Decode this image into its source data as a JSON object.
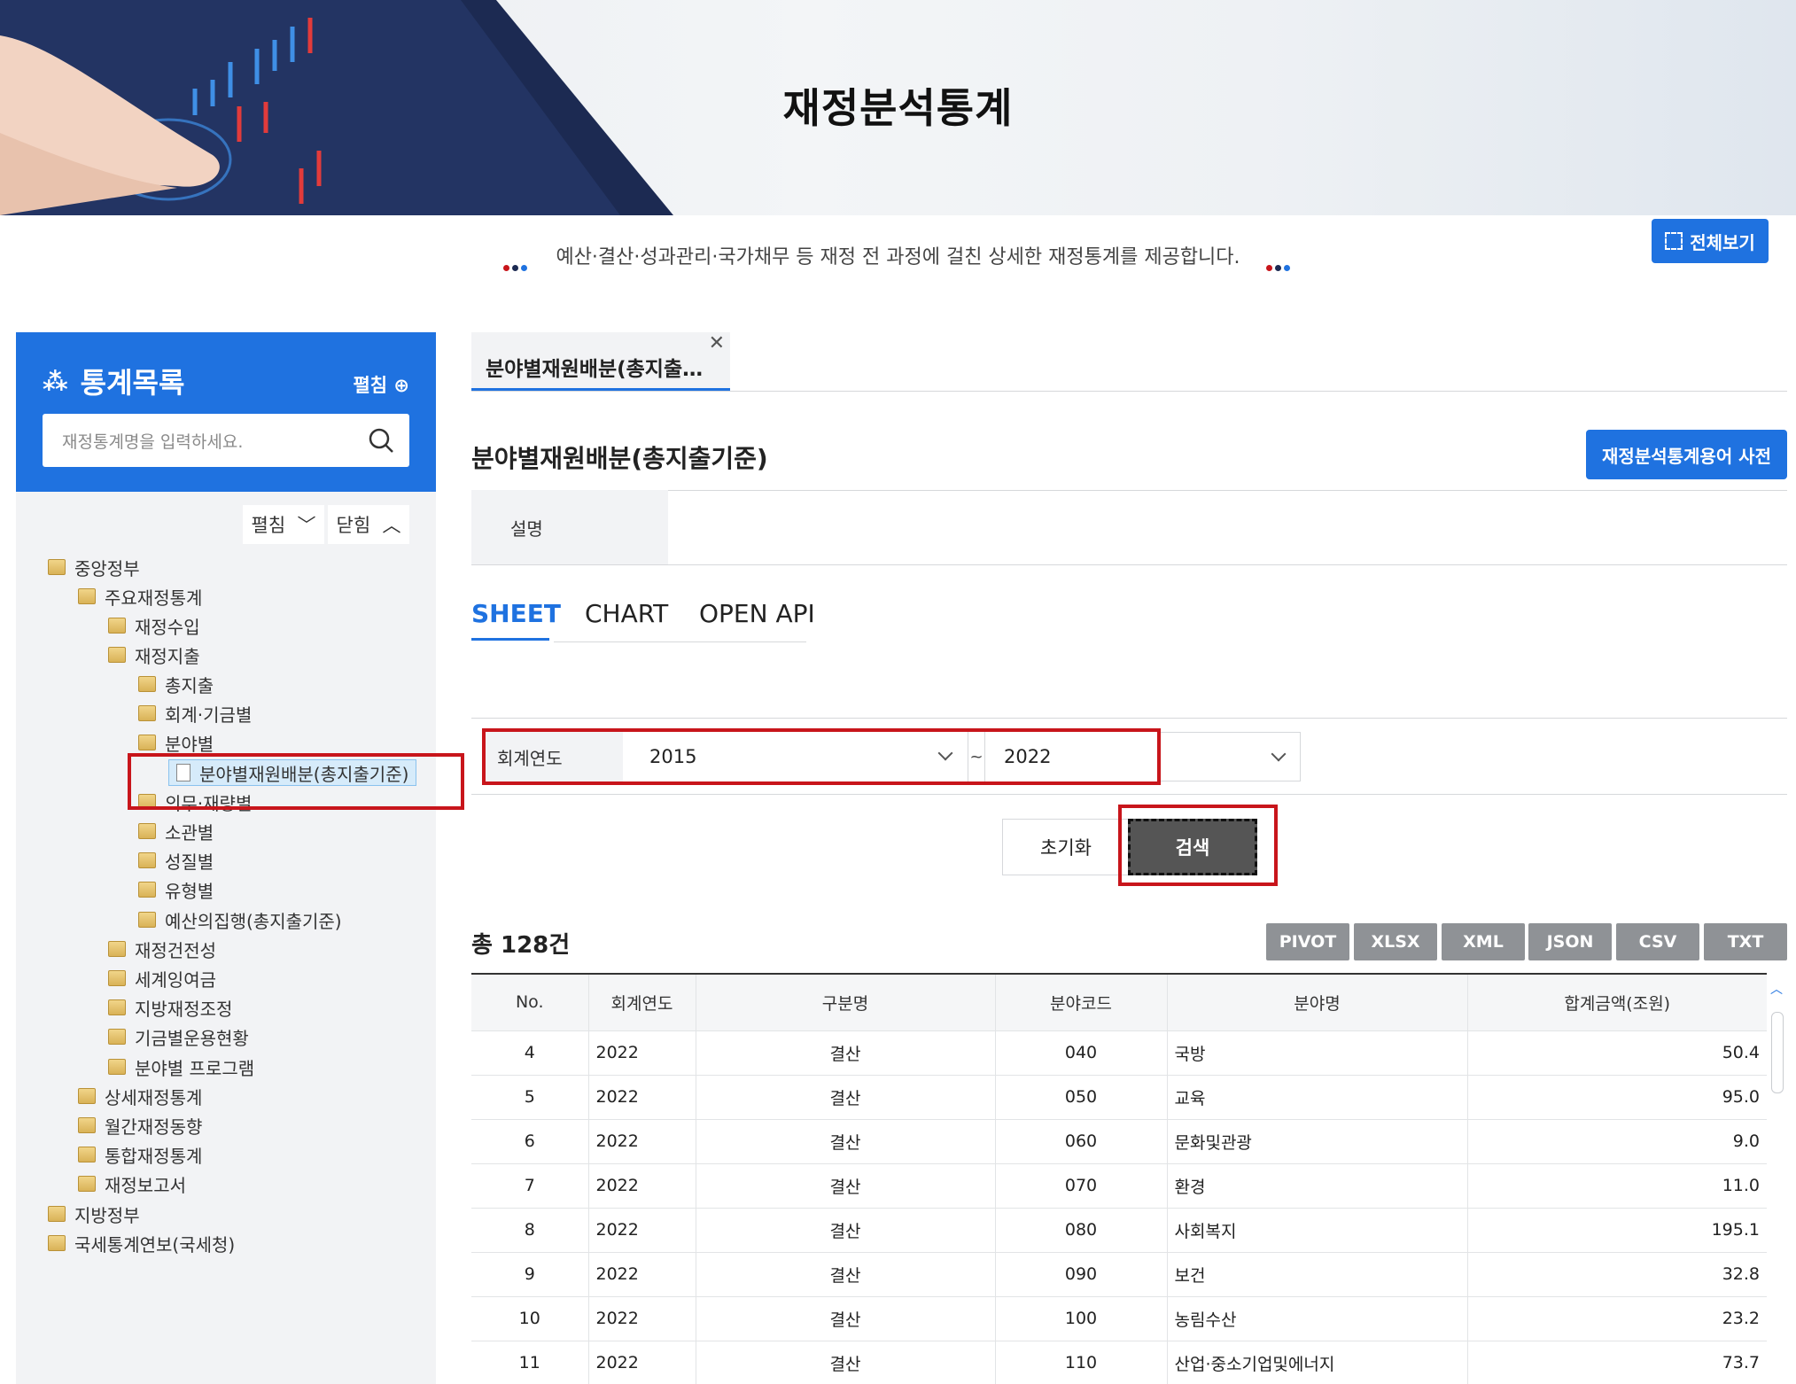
{
  "banner": {
    "title": "재정분석통계"
  },
  "subtitle": "예산·결산·성과관리·국가채무 등 재정 전 과정에 걸친 상세한 재정통계를 제공합니다.",
  "fullview_label": "전체보기",
  "sidebar": {
    "title": "통계목록",
    "expand_label": "펼침",
    "search_placeholder": "재정통계명을 입력하세요.",
    "tree_expand": "펼침",
    "tree_collapse": "닫힘",
    "tree": [
      {
        "label": "중앙정부",
        "level": 0
      },
      {
        "label": "주요재정통계",
        "level": 1
      },
      {
        "label": "재정수입",
        "level": 2
      },
      {
        "label": "재정지출",
        "level": 2
      },
      {
        "label": "총지출",
        "level": 3
      },
      {
        "label": "회계·기금별",
        "level": 3
      },
      {
        "label": "분야별",
        "level": 3
      },
      {
        "label": "분야별재원배분(총지출기준)",
        "level": 4,
        "selected": true
      },
      {
        "label": "의무·재량별",
        "level": 3
      },
      {
        "label": "소관별",
        "level": 3
      },
      {
        "label": "성질별",
        "level": 3
      },
      {
        "label": "유형별",
        "level": 3
      },
      {
        "label": "예산의집행(총지출기준)",
        "level": 3
      },
      {
        "label": "재정건전성",
        "level": 2
      },
      {
        "label": "세계잉여금",
        "level": 2
      },
      {
        "label": "지방재정조정",
        "level": 2
      },
      {
        "label": "기금별운용현황",
        "level": 2
      },
      {
        "label": "분야별 프로그램",
        "level": 2
      },
      {
        "label": "상세재정통계",
        "level": 1
      },
      {
        "label": "월간재정동향",
        "level": 1
      },
      {
        "label": "통합재정통계",
        "level": 1
      },
      {
        "label": "재정보고서",
        "level": 1
      },
      {
        "label": "지방정부",
        "level": 0
      },
      {
        "label": "국세통계연보(국세청)",
        "level": 0
      }
    ]
  },
  "tab": {
    "label": "분야별재원배분(총지출…",
    "close": "✕"
  },
  "page_title": "분야별재원배분(총지출기준)",
  "dictionary_button": "재정분석통계용어 사전",
  "description_label": "설명",
  "view_tabs": [
    "SHEET",
    "CHART",
    "OPEN API"
  ],
  "filter": {
    "label": "회계연도",
    "from": "2015",
    "tilde": "~",
    "to": "2022",
    "extra": ""
  },
  "reset_label": "초기화",
  "search_label": "검색",
  "total_label": "총 128건",
  "downloads": [
    "PIVOT",
    "XLSX",
    "XML",
    "JSON",
    "CSV",
    "TXT"
  ],
  "table": {
    "headers": [
      "No.",
      "회계연도",
      "구분명",
      "분야코드",
      "분야명",
      "합계금액(조원)"
    ],
    "rows": [
      [
        "4",
        "2022",
        "결산",
        "040",
        "국방",
        "50.4"
      ],
      [
        "5",
        "2022",
        "결산",
        "050",
        "교육",
        "95.0"
      ],
      [
        "6",
        "2022",
        "결산",
        "060",
        "문화및관광",
        "9.0"
      ],
      [
        "7",
        "2022",
        "결산",
        "070",
        "환경",
        "11.0"
      ],
      [
        "8",
        "2022",
        "결산",
        "080",
        "사회복지",
        "195.1"
      ],
      [
        "9",
        "2022",
        "결산",
        "090",
        "보건",
        "32.8"
      ],
      [
        "10",
        "2022",
        "결산",
        "100",
        "농림수산",
        "23.2"
      ],
      [
        "11",
        "2022",
        "결산",
        "110",
        "산업·중소기업및에너지",
        "73.7"
      ]
    ]
  },
  "colors": {
    "accent": "#1f72e0",
    "highlight": "#c8151b",
    "sheet_active": "#1f72e0"
  }
}
